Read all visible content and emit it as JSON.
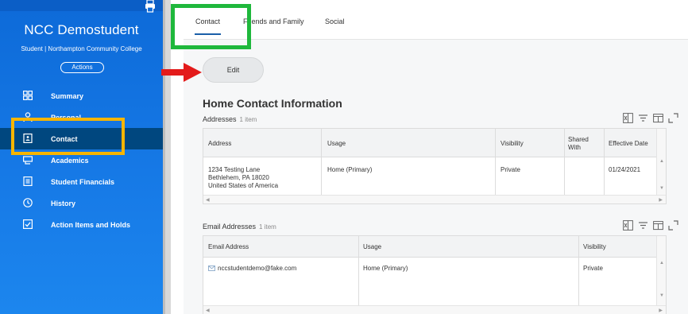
{
  "colors": {
    "sidebar_top": "#0d6ad8",
    "sidebar_bottom": "#1c86ee",
    "nav_active": "#00477f",
    "tab_underline": "#1a5fa8",
    "link": "#1a6fc1",
    "highlight_green": "#1fb83c",
    "highlight_orange": "#f7b500",
    "highlight_red": "#e31b1b"
  },
  "sidebar": {
    "student_name": "NCC Demostudent",
    "subtitle": "Student | Northampton Community College",
    "actions_label": "Actions",
    "print_icon": "print-icon",
    "items": [
      {
        "label": "Summary",
        "icon": "grid-icon",
        "active": false
      },
      {
        "label": "Personal",
        "icon": "person-icon",
        "active": false
      },
      {
        "label": "Contact",
        "icon": "contact-card-icon",
        "active": true
      },
      {
        "label": "Academics",
        "icon": "graduation-cap-icon",
        "active": false
      },
      {
        "label": "Student Financials",
        "icon": "document-icon",
        "active": false
      },
      {
        "label": "History",
        "icon": "clock-icon",
        "active": false
      },
      {
        "label": "Action Items and Holds",
        "icon": "checklist-icon",
        "active": false
      }
    ]
  },
  "tabs": [
    {
      "label": "Contact",
      "active": true
    },
    {
      "label": "Friends and Family",
      "active": false
    },
    {
      "label": "Social",
      "active": false
    }
  ],
  "edit_label": "Edit",
  "section_title": "Home Contact Information",
  "addresses": {
    "title": "Addresses",
    "count": "1 item",
    "columns": [
      "Address",
      "Usage",
      "Visibility",
      "Shared With",
      "Effective Date"
    ],
    "rows": [
      {
        "address_lines": [
          "1234 Testing Lane",
          "Bethlehem, PA 18020",
          "United States of America"
        ],
        "usage": "Home (Primary)",
        "visibility": "Private",
        "shared_with": "",
        "effective_date": "01/24/2021"
      }
    ]
  },
  "emails": {
    "title": "Email Addresses",
    "count": "1 item",
    "columns": [
      "Email Address",
      "Usage",
      "Visibility"
    ],
    "rows": [
      {
        "email": "nccstudentdemo@fake.com",
        "usage": "Home (Primary)",
        "visibility": "Private"
      }
    ]
  },
  "table_tools": [
    "excel-export-icon",
    "filter-icon",
    "column-chooser-icon",
    "fullscreen-icon"
  ]
}
